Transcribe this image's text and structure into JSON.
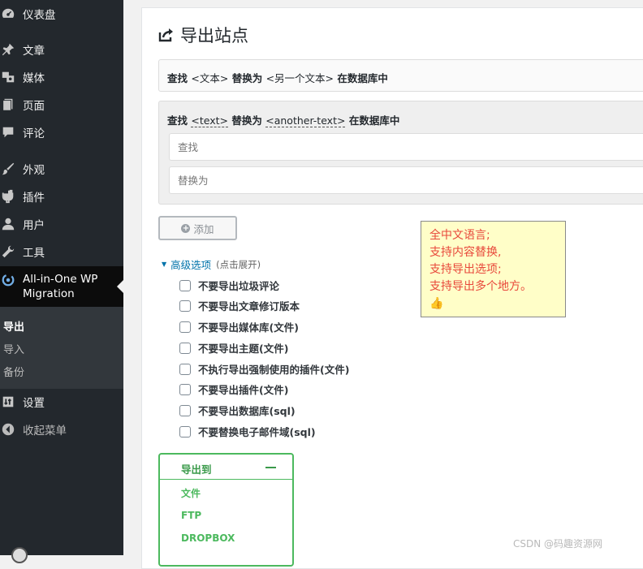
{
  "sidebar": {
    "items": [
      {
        "label": "仪表盘",
        "icon": "dashboard-icon"
      },
      {
        "label": "文章",
        "icon": "pushpin-icon"
      },
      {
        "label": "媒体",
        "icon": "media-icon"
      },
      {
        "label": "页面",
        "icon": "page-icon"
      },
      {
        "label": "评论",
        "icon": "comment-icon"
      },
      {
        "label": "外观",
        "icon": "brush-icon"
      },
      {
        "label": "插件",
        "icon": "plugin-icon"
      },
      {
        "label": "用户",
        "icon": "user-icon"
      },
      {
        "label": "工具",
        "icon": "wrench-icon"
      }
    ],
    "plugin": {
      "label": "All-in-One WP Migration",
      "icon": "migration-icon"
    },
    "submenu": [
      {
        "label": "导出",
        "current": true
      },
      {
        "label": "导入",
        "current": false
      },
      {
        "label": "备份",
        "current": false
      }
    ],
    "settings_label": "设置",
    "collapse_label": "收起菜单"
  },
  "main": {
    "title": "导出站点",
    "simple_find": {
      "prefix": "查找",
      "tag1": "<文本>",
      "middle": "替换为",
      "tag2": "<另一个文本>",
      "suffix": "在数据库中"
    },
    "replace_box": {
      "prefix": "查找",
      "tag1": "<text>",
      "middle": "替换为",
      "tag2": "<another-text>",
      "suffix": "在数据库中",
      "find_placeholder": "查找",
      "replace_placeholder": "替换为"
    },
    "add_button": "添加",
    "note": [
      "全中文语言;",
      "支持内容替换,",
      "支持导出选项;",
      "支持导出多个地方。",
      "👍"
    ],
    "advanced": {
      "label": "高级选项",
      "hint": "(点击展开)",
      "options": [
        "不要导出垃圾评论",
        "不要导出文章修订版本",
        "不要导出媒体库(文件)",
        "不要导出主题(文件)",
        "不执行导出强制使用的插件(文件)",
        "不要导出插件(文件)",
        "不要导出数据库(sql)",
        "不要替换电子邮件域(sql)"
      ]
    },
    "export_to": {
      "label": "导出到",
      "options": [
        "文件",
        "FTP",
        "DROPBOX"
      ]
    }
  },
  "watermark": "CSDN @码趣资源网",
  "colors": {
    "sidebar_bg": "#23282d",
    "link_blue": "#0073aa",
    "export_green": "#4cb95e",
    "note_red": "#e8483b",
    "note_bg": "#fffec8"
  }
}
